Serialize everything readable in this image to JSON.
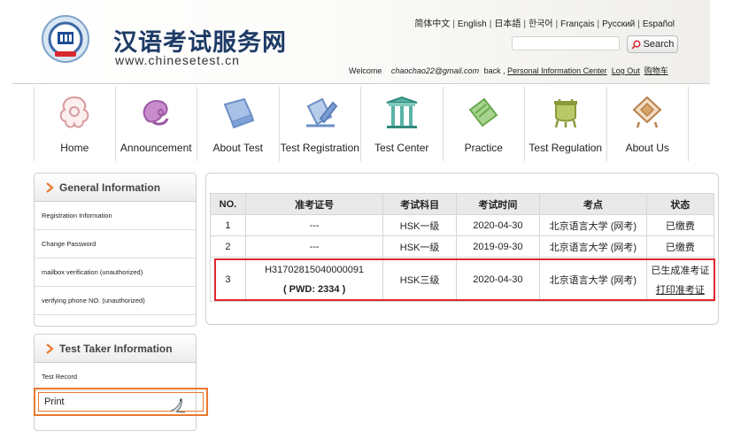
{
  "header": {
    "brand_cn": "汉语考试服务网",
    "brand_url": "www.chinesetest.cn",
    "languages": [
      "简体中文",
      "English",
      "日本語",
      "한국어",
      "Français",
      "Русский",
      "Español"
    ],
    "search_placeholder": "",
    "search_label": "Search",
    "welcome_text": "Welcome",
    "email": "chaochao22@gmail.com",
    "back_text": "back ,",
    "links": [
      "Personal Information Center",
      "Log Out",
      "购物车"
    ]
  },
  "nav": {
    "items": [
      {
        "label": "Home",
        "icon": "home-icon"
      },
      {
        "label": "Announcement",
        "icon": "announcement-icon"
      },
      {
        "label": "About Test",
        "icon": "about-test-icon"
      },
      {
        "label": "Test Registration",
        "icon": "test-registration-icon"
      },
      {
        "label": "Test Center",
        "icon": "test-center-icon"
      },
      {
        "label": "Practice",
        "icon": "practice-icon"
      },
      {
        "label": "Test Regulation",
        "icon": "test-regulation-icon"
      },
      {
        "label": "About Us",
        "icon": "about-us-icon"
      }
    ]
  },
  "sidebar": {
    "general": {
      "title": "General Information",
      "items": [
        "Registration Information",
        "Change Password",
        "mailbox verification (unauthorized)",
        "verifying phone NO. (unauthorized)"
      ]
    },
    "taker": {
      "title": "Test Taker Information",
      "items": [
        "Test Record",
        "Print"
      ]
    }
  },
  "table": {
    "headers": [
      "NO.",
      "准考证号",
      "考试科目",
      "考试时间",
      "考点",
      "状态"
    ],
    "rows": [
      {
        "no": "1",
        "id": "---",
        "pwd": "",
        "subject": "HSK一级",
        "time": "2020-04-30",
        "site": "北京语言大学 (网考)",
        "status": "已缴费",
        "action": ""
      },
      {
        "no": "2",
        "id": "---",
        "pwd": "",
        "subject": "HSK一级",
        "time": "2019-09-30",
        "site": "北京语言大学 (网考)",
        "status": "已缴费",
        "action": ""
      },
      {
        "no": "3",
        "id": "H31702815040000091",
        "pwd": "( PWD: 2334 )",
        "subject": "HSK三级",
        "time": "2020-04-30",
        "site": "北京语言大学 (网考)",
        "status": "已生成准考证",
        "action": "打印准考证"
      }
    ]
  },
  "colors": {
    "highlight_red": "#e0262e",
    "highlight_orange": "#e8792f",
    "brand_blue": "#1e3b66"
  }
}
